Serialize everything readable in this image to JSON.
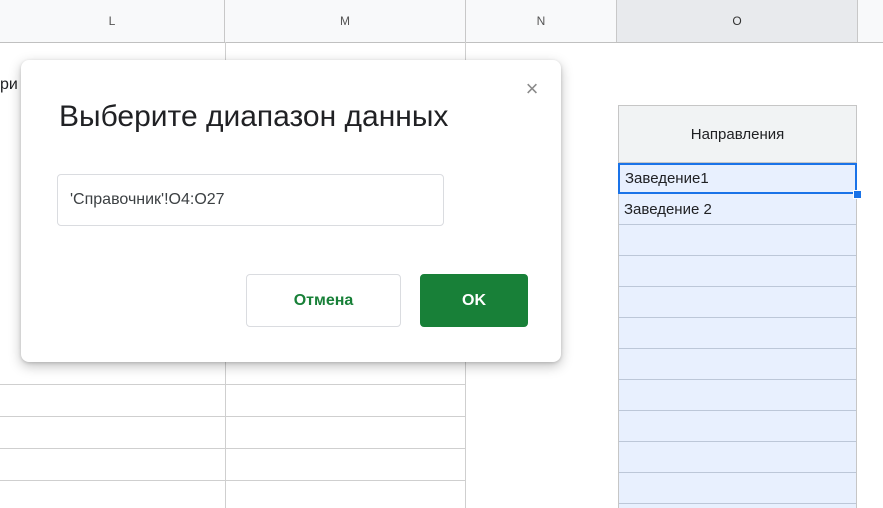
{
  "columns": [
    {
      "label": "L",
      "selected": false
    },
    {
      "label": "M",
      "selected": false
    },
    {
      "label": "N",
      "selected": false
    },
    {
      "label": "O",
      "selected": true
    }
  ],
  "sheet": {
    "partial_text": "ри",
    "o_header": "Направления",
    "o_cells": [
      "Заведение1",
      "Заведение 2",
      "",
      "",
      "",
      "",
      "",
      "",
      "",
      "",
      ""
    ]
  },
  "dialog": {
    "title": "Выберите диапазон данных",
    "close_symbol": "×",
    "range_value": "'Справочник'!O4:O27",
    "cancel_label": "Отмена",
    "ok_label": "OK"
  },
  "colors": {
    "accent_green": "#188038",
    "selection_blue": "#1a73e8",
    "selection_fill": "#e8f0fe"
  }
}
